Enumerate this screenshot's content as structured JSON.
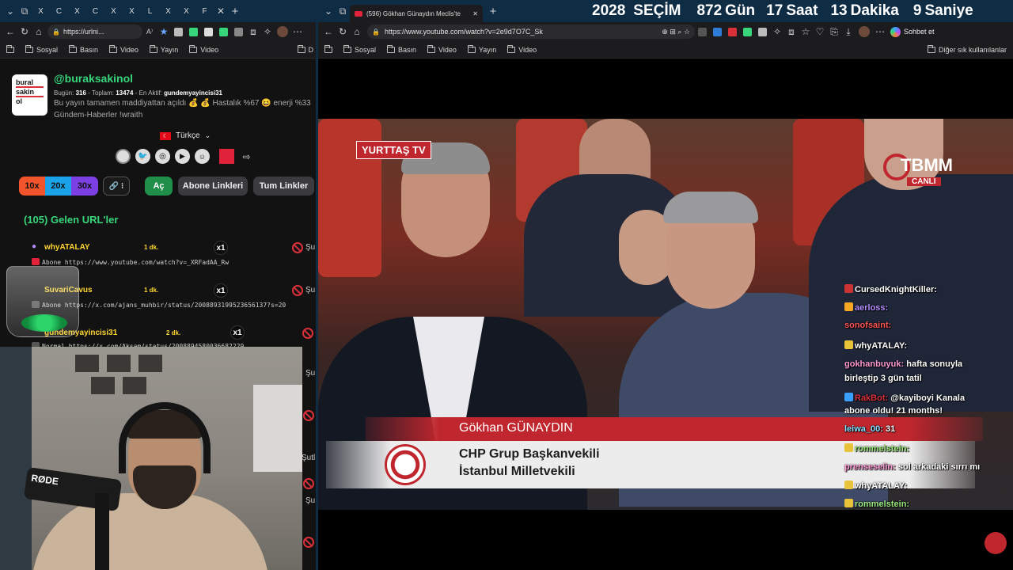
{
  "left_browser": {
    "tabs": [
      "X",
      "C",
      "X",
      "C",
      "X",
      "X",
      "L",
      "X",
      "X",
      "F"
    ],
    "url": "https://urlni...",
    "bookmarks": [
      "Sosyal",
      "Basın",
      "Video",
      "Yayın",
      "Video",
      "D"
    ]
  },
  "right_browser": {
    "active_tab_title": "(596) Gökhan Günaydın Meclis'te",
    "url": "https://www.youtube.com/watch?v=2e9d7O7C_Sk",
    "bookmarks": [
      "Sosyal",
      "Basın",
      "Video",
      "Yayın",
      "Video"
    ],
    "other_bookmarks": "Diğer sık kullanılanlar",
    "chat_button": "Sohbet et"
  },
  "countdown": {
    "year": "2028",
    "label": "SEÇİM",
    "days": "872",
    "days_unit": "Gün",
    "hours": "17",
    "hours_unit": "Saat",
    "minutes": "13",
    "minutes_unit": "Dakika",
    "seconds": "9",
    "seconds_unit": "Saniye"
  },
  "profile": {
    "logo_lines": [
      "bural",
      "sakin",
      "ol"
    ],
    "handle": "@buraksakinol",
    "today_label": "Bugün:",
    "today_value": "316",
    "total_label": "Toplam:",
    "total_value": "13474",
    "most_active_label": "En Aktif:",
    "most_active_value": "gundemyayincisi31",
    "bio": "Bu yayın tamamen maddiyattan açıldı 💰 💰 Hastalık %67 😆 enerji %33",
    "bio2": "Gündem-Haberler !wraith",
    "language": "Türkçe"
  },
  "controls": {
    "speed_buttons": [
      "10x",
      "20x",
      "30x"
    ],
    "open_button": "Aç",
    "subscriber_links": "Abone Linkleri",
    "all_links": "Tum Linkler"
  },
  "urls": {
    "header": "(105) Gelen URL'ler",
    "rows": [
      {
        "user": "whyATALAY",
        "time": "1 dk.",
        "count": "x1",
        "text": "Abone https://www.youtube.com/watch?v=_XRFadAA_Rw",
        "cut": "Şu"
      },
      {
        "user": "SuvariCavus",
        "time": "1 dk.",
        "count": "x1",
        "text": "Abone https://x.com/ajans_muhbir/status/2008893199523656137?s=20",
        "cut": "Şu"
      },
      {
        "user": "gundemyayincisi31",
        "time": "2 dk.",
        "count": "x1",
        "text": "Normal https://x.com/Aksam/status/2008894580036682229",
        "cut": "Şu"
      }
    ],
    "cut_labels": [
      "Şu",
      "Şutl",
      "Şu"
    ]
  },
  "webcam": {
    "mic_brand": "RØDE"
  },
  "broadcast": {
    "channel_logo": "YURTTAŞ TV",
    "tbmm": "TBMM",
    "live": "CANLI",
    "speaker_name": "Gökhan GÜNAYDIN",
    "title_line1": "CHP Grup Başkanvekili",
    "title_line2": "İstanbul Milletvekili"
  },
  "chat": [
    {
      "user": "CursedKnightKiller:",
      "msg": "",
      "color": "#ffffff",
      "badge": "#c33"
    },
    {
      "user": "aerloss:",
      "msg": "",
      "color": "#b38cff",
      "badge": "#f5a623"
    },
    {
      "user": "sonofsaint:",
      "msg": "",
      "color": "#ff5555",
      "badge": ""
    },
    {
      "user": "whyATALAY:",
      "msg": "",
      "color": "#ffffff",
      "badge": "#e8c33a"
    },
    {
      "user": "gokhanbuyuk:",
      "msg": "hafta sonuyla",
      "color": "#ff9ad5",
      "badge": ""
    },
    {
      "user": "",
      "msg": "birleştip 3 gün tatil",
      "color": "#ffffff",
      "badge": ""
    },
    {
      "user": "RakBot:",
      "msg": "@kayiboyi Kanala",
      "color": "#d9303a",
      "badge": "#3aa0ff"
    },
    {
      "user": "",
      "msg": "abone oldu! 21 months!",
      "color": "#ffffff",
      "badge": ""
    },
    {
      "user": "leiwa_00:",
      "msg": "31",
      "color": "#7fe0ff",
      "badge": ""
    },
    {
      "user": "rommelstein:",
      "msg": "",
      "color": "#9be87a",
      "badge": "#e8c33a"
    },
    {
      "user": "prenseselin:",
      "msg": "sol arkadaki sırrı mı",
      "color": "#ff9ad5",
      "badge": ""
    },
    {
      "user": "whyATALAY:",
      "msg": "",
      "color": "#ffffff",
      "badge": "#e8c33a"
    },
    {
      "user": "rommelstein:",
      "msg": "",
      "color": "#9be87a",
      "badge": "#e8c33a"
    }
  ],
  "colors": {
    "accent_green": "#37d67a",
    "countdown_bg": "#0f2c45",
    "lower_third_red": "#c0262d",
    "speed_orange": "#f2552c",
    "speed_blue": "#1aa3e8",
    "speed_purple": "#7b3fe4",
    "open_green": "#1f8f4a"
  }
}
